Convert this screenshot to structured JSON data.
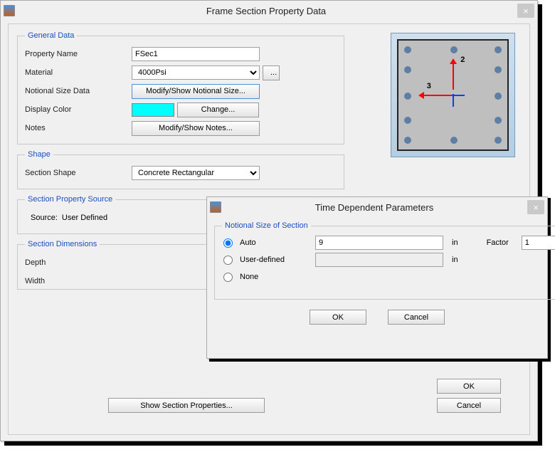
{
  "main": {
    "title": "Frame Section Property Data",
    "general": {
      "legend": "General Data",
      "propertyName_label": "Property Name",
      "propertyName_value": "FSec1",
      "material_label": "Material",
      "material_value": "4000Psi",
      "notional_label": "Notional Size Data",
      "notional_button": "Modify/Show Notional Size...",
      "displayColor_label": "Display Color",
      "change_button": "Change...",
      "notes_label": "Notes",
      "notes_button": "Modify/Show Notes..."
    },
    "shape": {
      "legend": "Shape",
      "sectionShape_label": "Section Shape",
      "sectionShape_value": "Concrete Rectangular"
    },
    "source": {
      "legend": "Section Property Source",
      "source_label": "Source:",
      "source_value": "User Defined"
    },
    "dims": {
      "legend": "Section Dimensions",
      "depth_label": "Depth",
      "width_label": "Width"
    },
    "showSectionProps_button": "Show Section Properties...",
    "ok_button": "OK",
    "cancel_button": "Cancel",
    "axis2": "2",
    "axis3": "3"
  },
  "sub": {
    "title": "Time Dependent Parameters",
    "legend": "Notional Size of Section",
    "opt_auto": "Auto",
    "opt_user": "User-defined",
    "opt_none": "None",
    "auto_value": "9",
    "user_value": "",
    "unit": "in",
    "factor_label": "Factor",
    "factor_value": "1",
    "ok_button": "OK",
    "cancel_button": "Cancel"
  }
}
